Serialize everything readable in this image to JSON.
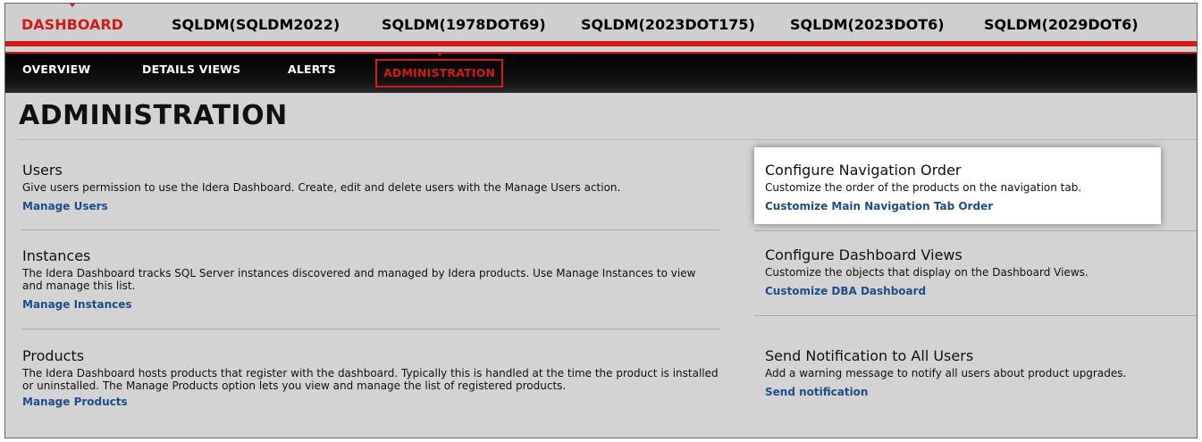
{
  "top_tabs": [
    {
      "label": "DASHBOARD",
      "active": true
    },
    {
      "label": "SQLDM(SQLDM2022)"
    },
    {
      "label": "SQLDM(1978DOT69)"
    },
    {
      "label": "SQLDM(2023DOT175)"
    },
    {
      "label": "SQLDM(2023DOT6)"
    },
    {
      "label": "SQLDM(2029DOT6)"
    }
  ],
  "sub_nav": [
    {
      "label": "OVERVIEW"
    },
    {
      "label": "DETAILS VIEWS"
    },
    {
      "label": "ALERTS"
    },
    {
      "label": "ADMINISTRATION",
      "active": true
    }
  ],
  "page_title": "ADMINISTRATION",
  "left_sections": [
    {
      "heading": "Users",
      "description": "Give users permission to use the Idera Dashboard. Create, edit and delete users with the Manage Users action.",
      "link": "Manage Users"
    },
    {
      "heading": "Instances",
      "description": "The Idera Dashboard tracks SQL Server instances discovered and managed by Idera products. Use Manage Instances to view and manage this list.",
      "link": "Manage Instances"
    },
    {
      "heading": "Products",
      "description": "The Idera Dashboard hosts products that register with the dashboard. Typically this is handled at the time the product is installed or uninstalled. The Manage Products option lets you view and manage the list of registered products.",
      "link": "Manage Products"
    }
  ],
  "right_sections": [
    {
      "heading": "Configure Navigation Order",
      "description": "Customize the order of the products on the navigation tab.",
      "link": "Customize Main Navigation Tab Order"
    },
    {
      "heading": "Configure Dashboard Views",
      "description": "Customize the objects that display on the Dashboard Views.",
      "link": "Customize DBA Dashboard"
    },
    {
      "heading": "Send Notification to All Users",
      "description": "Add a warning message to notify all users about product upgrades.",
      "link": "Send notification"
    }
  ],
  "colors": {
    "accent_red": "#d11a1a",
    "link_blue": "#1f4d8c",
    "background_gray": "#d3d3d3"
  }
}
